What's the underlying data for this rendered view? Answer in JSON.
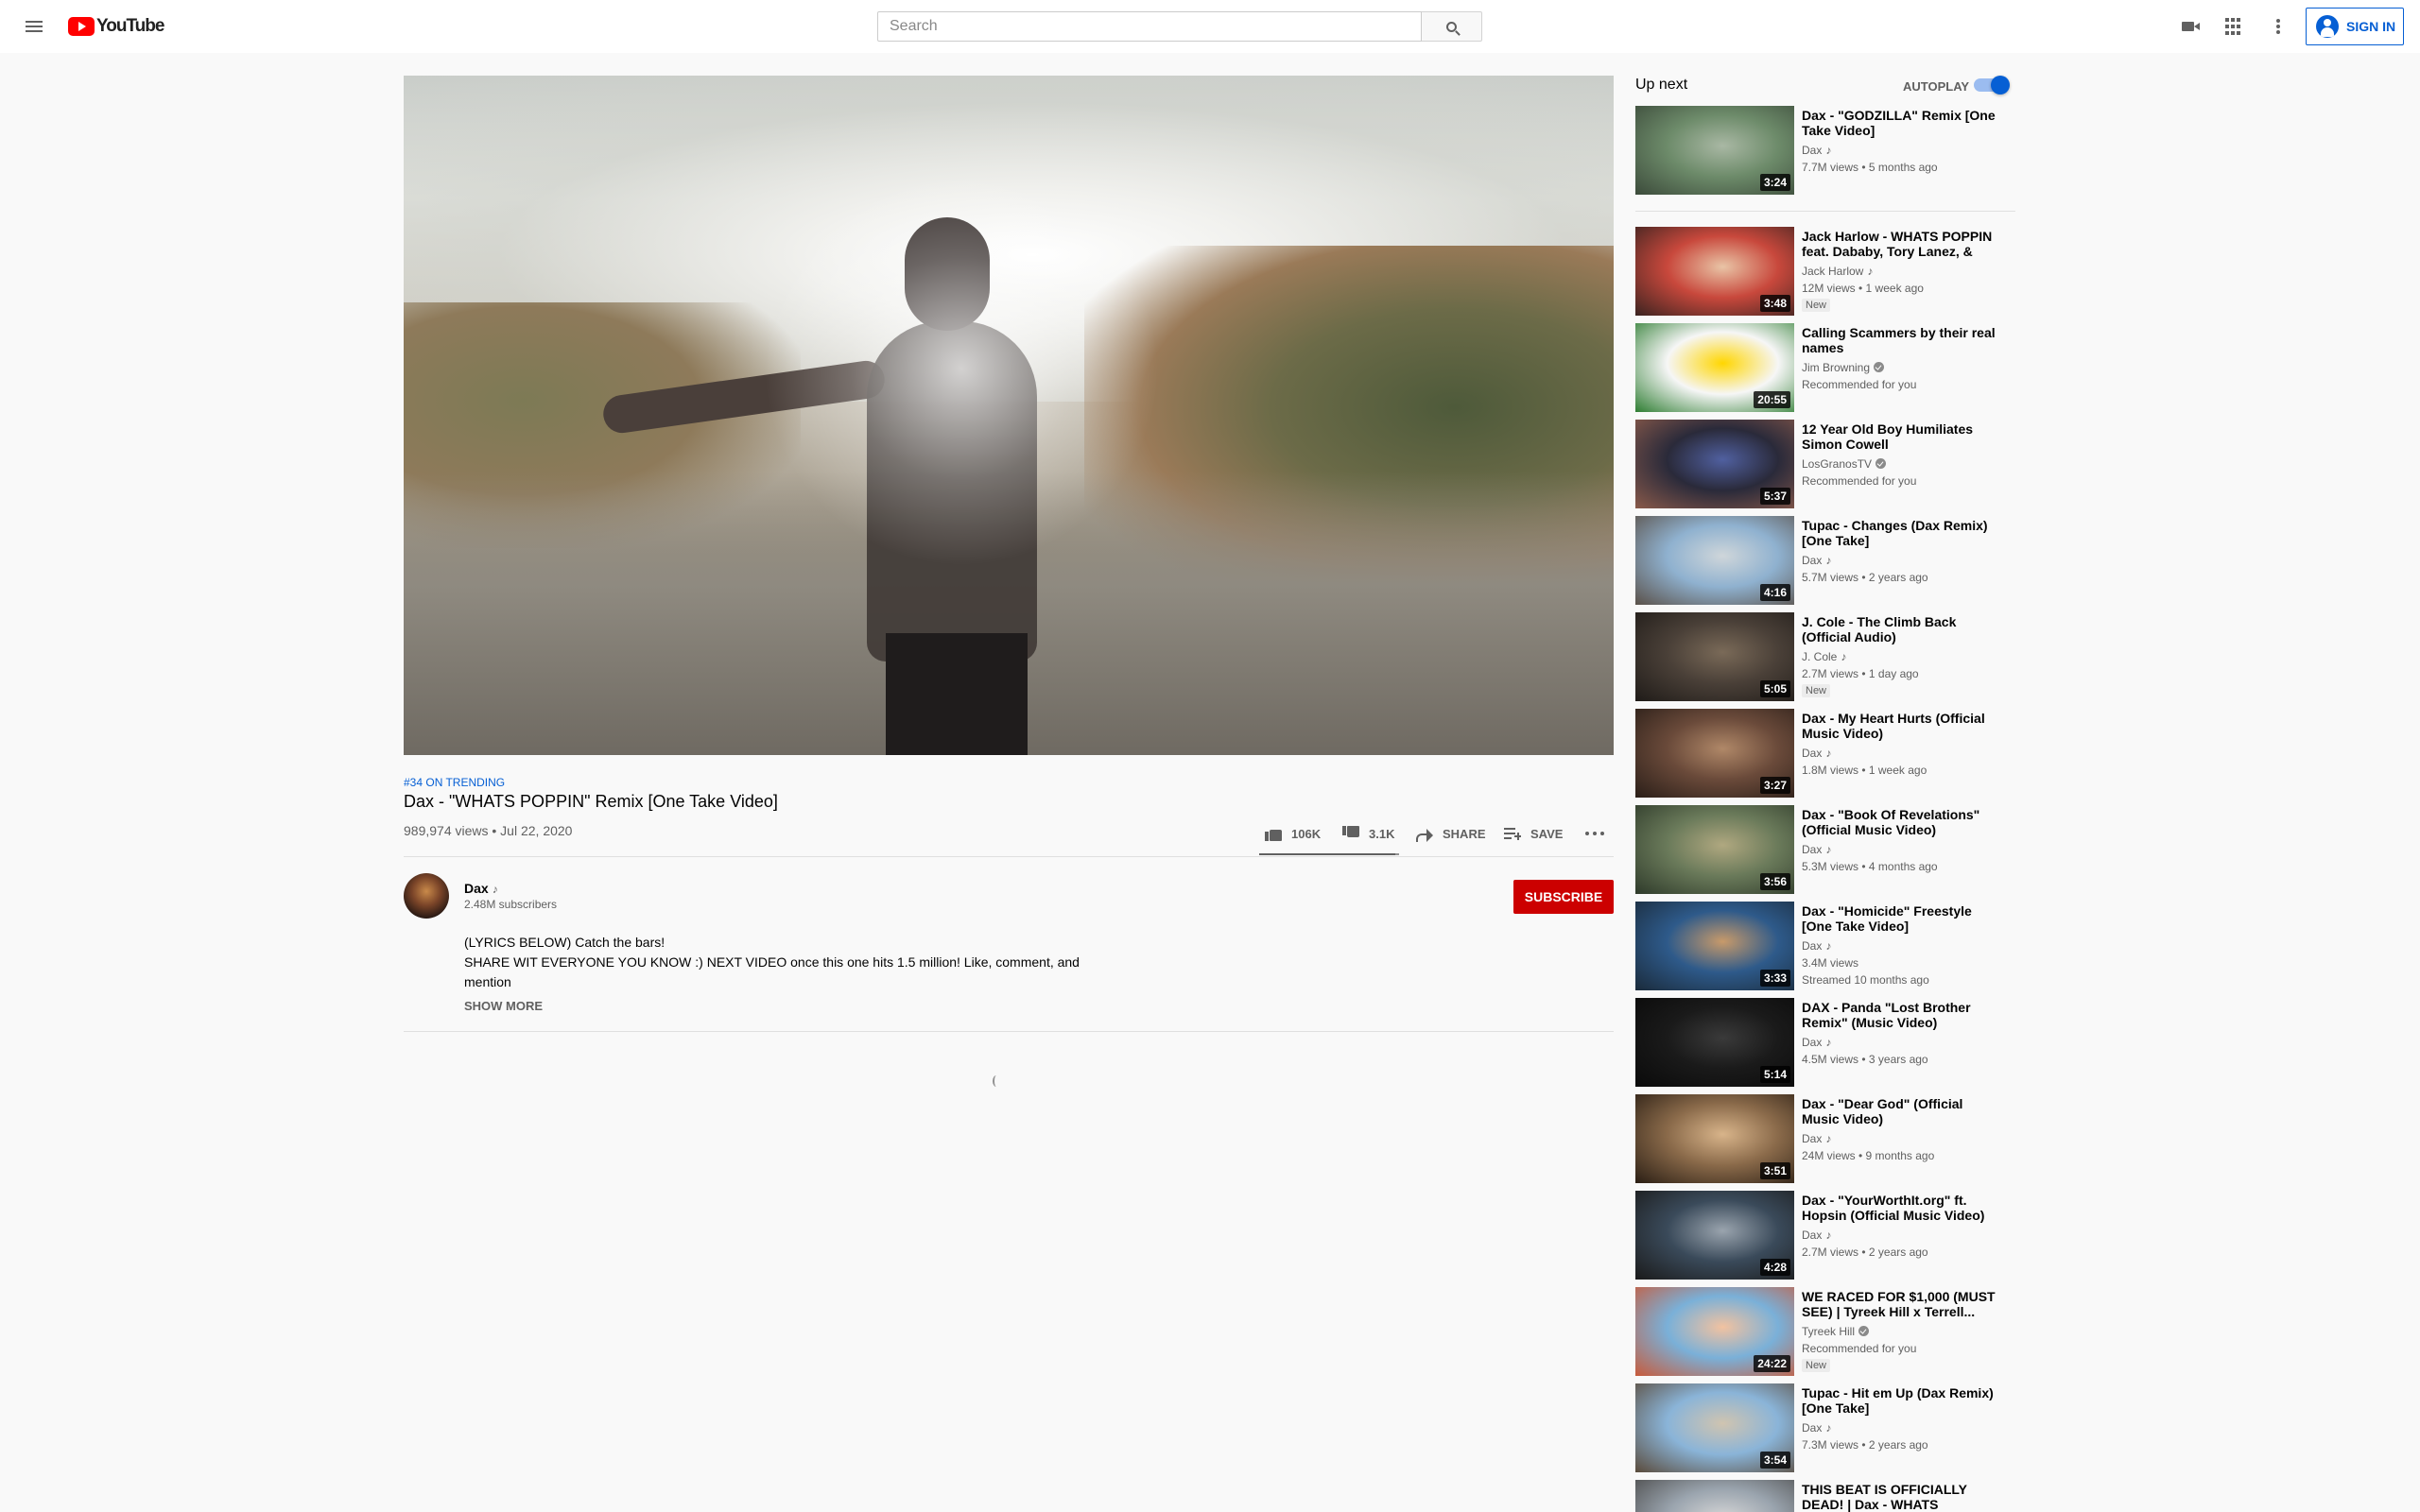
{
  "header": {
    "logo_text": "YouTube",
    "search_placeholder": "Search",
    "sign_in_label": "SIGN IN"
  },
  "video": {
    "trending": "#34 ON TRENDING",
    "title": "Dax - \"WHATS POPPIN\" Remix [One Take Video]",
    "meta": "989,974 views • Jul 22, 2020",
    "likes": "106K",
    "dislikes": "3.1K",
    "share_label": "SHARE",
    "save_label": "SAVE",
    "like_ratio": 0.97
  },
  "owner": {
    "name": "Dax",
    "music_note": "♪",
    "subscribers": "2.48M subscribers",
    "subscribe_label": "SUBSCRIBE"
  },
  "description": {
    "line1": "(LYRICS BELOW) Catch the bars!",
    "line2": "SHARE WIT EVERYONE YOU KNOW :) NEXT VIDEO once this one hits 1.5 million! Like, comment, and mention",
    "show_more": "SHOW MORE"
  },
  "upnext": {
    "title": "Up next",
    "autoplay_label": "AUTOPLAY",
    "autoplay_on": true
  },
  "recommendations": [
    {
      "title": "Dax - \"GODZILLA\" Remix [One Take Video]",
      "channel": "Dax",
      "note": true,
      "verified": false,
      "meta": "7.7M views • 5 months ago",
      "badge": "",
      "duration": "3:24",
      "thumb_colors": [
        "#6d8b6a",
        "#3b4a3a",
        "#a9b8a4"
      ]
    },
    {
      "title": "Jack Harlow - WHATS POPPIN feat. Dababy, Tory Lanez, & Lil...",
      "channel": "Jack Harlow",
      "note": true,
      "verified": false,
      "meta": "12M views • 1 week ago",
      "badge": "New",
      "duration": "3:48",
      "thumb_colors": [
        "#c8483c",
        "#3a2320",
        "#e9c4a6"
      ]
    },
    {
      "title": "Calling Scammers by their real names",
      "channel": "Jim Browning",
      "note": false,
      "verified": true,
      "meta": "Recommended for you",
      "badge": "",
      "duration": "20:55",
      "thumb_colors": [
        "#f6f6f6",
        "#2e7d32",
        "#ffd600"
      ]
    },
    {
      "title": "12 Year Old Boy Humiliates Simon Cowell",
      "channel": "LosGranosTV",
      "note": false,
      "verified": true,
      "meta": "Recommended for you",
      "badge": "",
      "duration": "5:37",
      "thumb_colors": [
        "#2a2a3a",
        "#8a5a4a",
        "#5060a0"
      ]
    },
    {
      "title": "Tupac - Changes (Dax Remix) [One Take]",
      "channel": "Dax",
      "note": true,
      "verified": false,
      "meta": "5.7M views • 2 years ago",
      "badge": "",
      "duration": "4:16",
      "thumb_colors": [
        "#8fb1cf",
        "#5a5048",
        "#cfd6da"
      ]
    },
    {
      "title": "J. Cole - The Climb Back (Official Audio)",
      "channel": "J. Cole",
      "note": true,
      "verified": false,
      "meta": "2.7M views • 1 day ago",
      "badge": "New",
      "duration": "5:05",
      "thumb_colors": [
        "#4a4038",
        "#1f1b18",
        "#7a6a58"
      ]
    },
    {
      "title": "Dax - My Heart Hurts (Official Music Video)",
      "channel": "Dax",
      "note": true,
      "verified": false,
      "meta": "1.8M views • 1 week ago",
      "badge": "",
      "duration": "3:27",
      "thumb_colors": [
        "#6a4a3a",
        "#2a1e18",
        "#b08868"
      ]
    },
    {
      "title": "Dax - \"Book Of Revelations\" (Official Music Video)",
      "channel": "Dax",
      "note": true,
      "verified": false,
      "meta": "5.3M views • 4 months ago",
      "badge": "",
      "duration": "3:56",
      "thumb_colors": [
        "#6a7a5a",
        "#2e3a2a",
        "#b0a880"
      ]
    },
    {
      "title": "Dax - \"Homicide\" Freestyle [One Take Video]",
      "channel": "Dax",
      "note": true,
      "verified": false,
      "meta": "3.4M views",
      "meta2": "Streamed 10 months ago",
      "badge": "",
      "duration": "3:33",
      "thumb_colors": [
        "#2e5a8a",
        "#1a2a3a",
        "#c89a6a"
      ]
    },
    {
      "title": "DAX - Panda \"Lost Brother Remix\" (Music Video)",
      "channel": "Dax",
      "note": true,
      "verified": false,
      "meta": "4.5M views • 3 years ago",
      "badge": "",
      "duration": "5:14",
      "thumb_colors": [
        "#1a1a1a",
        "#0a0a0a",
        "#3a3a3a"
      ]
    },
    {
      "title": "Dax - \"Dear God\" (Official Music Video)",
      "channel": "Dax",
      "note": true,
      "verified": false,
      "meta": "24M views • 9 months ago",
      "badge": "",
      "duration": "3:51",
      "thumb_colors": [
        "#8a6a4a",
        "#2a1e14",
        "#d8b48a"
      ]
    },
    {
      "title": "Dax - \"YourWorthIt.org\" ft. Hopsin (Official Music Video)",
      "channel": "Dax",
      "note": true,
      "verified": false,
      "meta": "2.7M views • 2 years ago",
      "badge": "",
      "duration": "4:28",
      "thumb_colors": [
        "#3a4a5a",
        "#1a1a1a",
        "#9aa4ae"
      ]
    },
    {
      "title": "WE RACED FOR $1,000 (MUST SEE) | Tyreek Hill x Terrell...",
      "channel": "Tyreek Hill",
      "note": false,
      "verified": true,
      "meta": "Recommended for you",
      "badge": "New",
      "duration": "24:22",
      "thumb_colors": [
        "#7ab0d8",
        "#c85a3a",
        "#f2c2a0"
      ]
    },
    {
      "title": "Tupac - Hit em Up (Dax Remix) [One Take]",
      "channel": "Dax",
      "note": true,
      "verified": false,
      "meta": "7.3M views • 2 years ago",
      "badge": "",
      "duration": "3:54",
      "thumb_colors": [
        "#8ab4d8",
        "#5a4a3a",
        "#d0c4b0"
      ]
    },
    {
      "title": "THIS BEAT IS OFFICIALLY DEAD! | Dax - WHATS POPPIN...",
      "channel": "",
      "note": false,
      "verified": false,
      "meta": "",
      "badge": "",
      "duration": "",
      "thumb_colors": [
        "#9aa4ae",
        "#4a4a4a",
        "#d8d8d8"
      ]
    }
  ]
}
